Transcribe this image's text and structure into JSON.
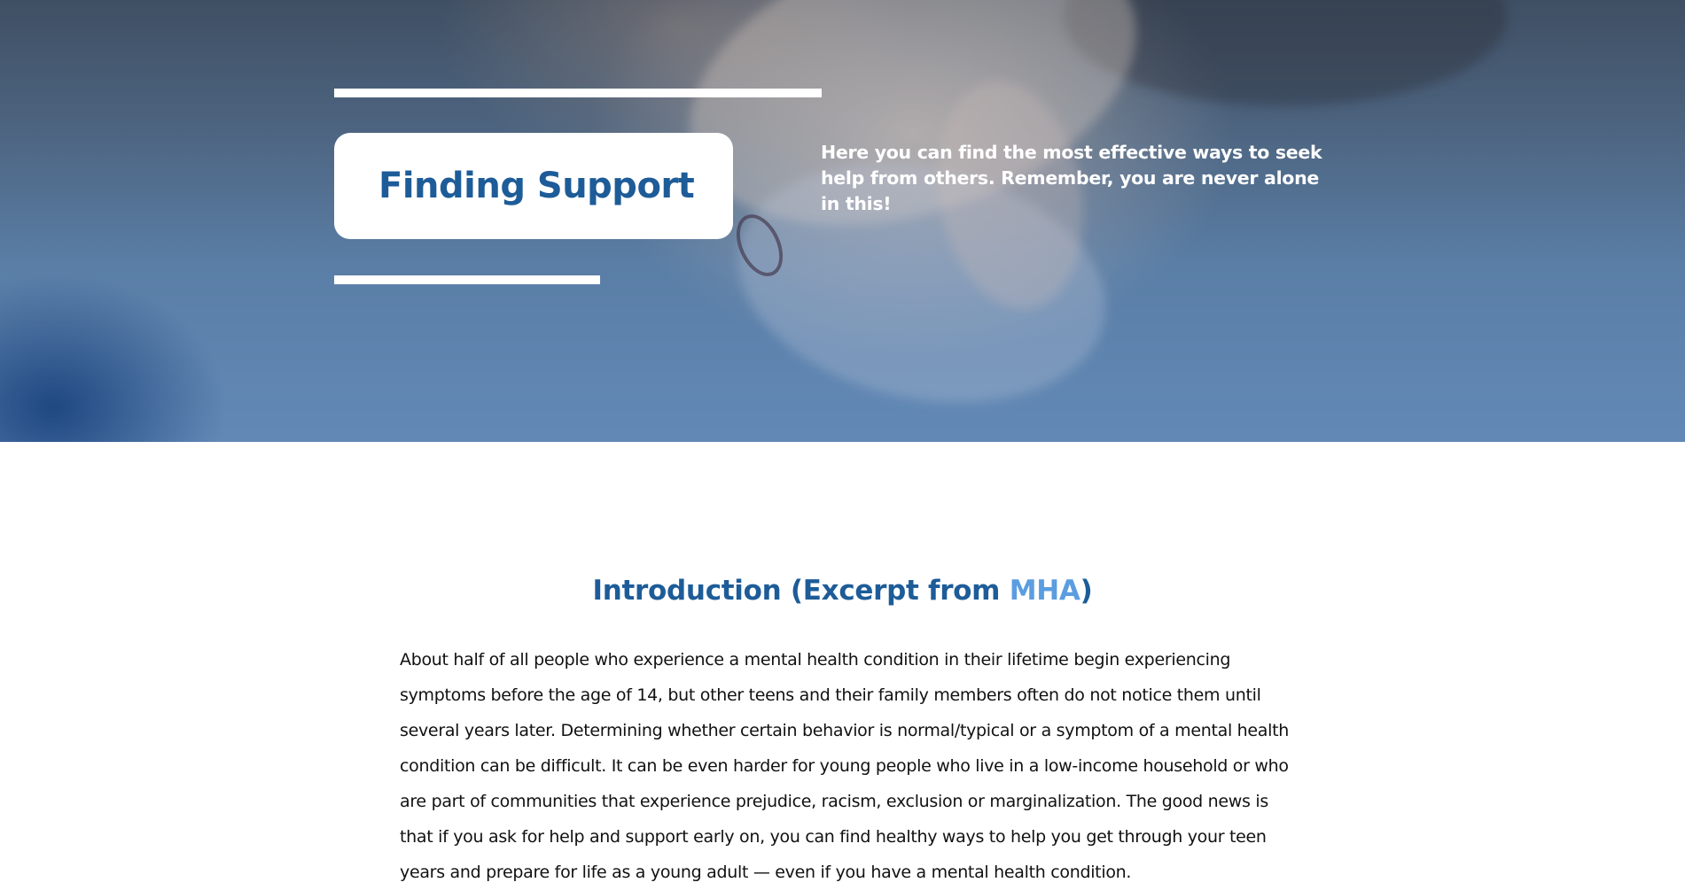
{
  "hero": {
    "title": "Finding Support",
    "description": "Here you can find the most effective ways to seek help from others. Remember, you are never alone in this!"
  },
  "intro": {
    "heading_prefix": "Introduction (Excerpt from ",
    "heading_link": "MHA",
    "heading_suffix": ")",
    "body": "About half of all people who experience a mental health condition in their lifetime begin experiencing symptoms before the age of 14, but other teens and their family members often do not notice them until several years later. Determining whether certain behavior is normal/typical or a symptom of a mental health condition can be difficult. It can be even harder for young people who live in a low-income household or who are part of communities that experience prejudice, racism, exclusion or marginalization. The good news is that if you ask for help and support early on, you can find healthy ways to help you get through your teen years and prepare for life as a young adult — even if you have a mental health condition."
  },
  "colors": {
    "heading_blue": "#1d5c98",
    "link_blue": "#5b9de0",
    "hero_overlay": "#5a7ea6"
  }
}
